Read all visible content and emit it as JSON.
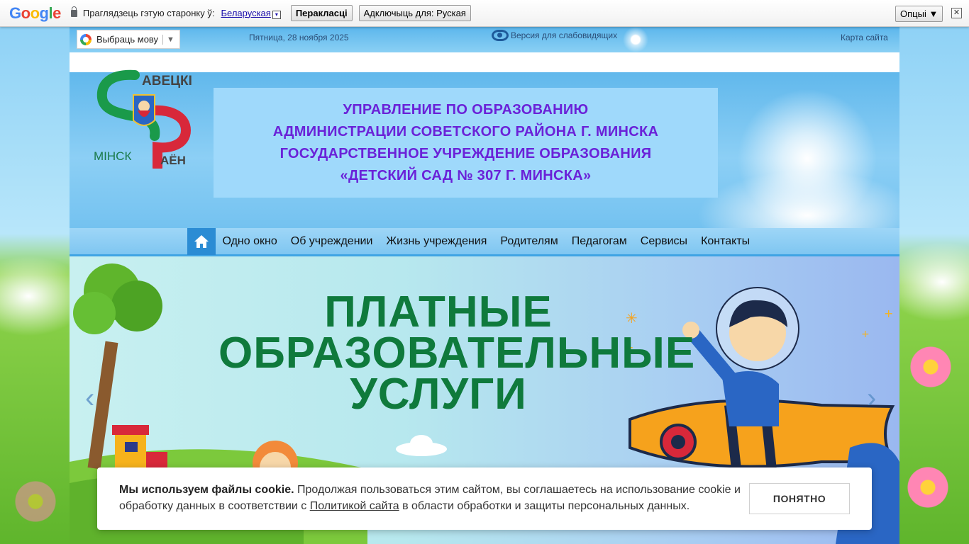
{
  "translate_bar": {
    "logo": [
      "G",
      "o",
      "o",
      "g",
      "l",
      "e"
    ],
    "prompt": "Праглядзець гэтую старонку ў:",
    "language": "Беларуская",
    "caret": "▾",
    "translate_button": "Перакласці",
    "turn_off_button": "Адключыць для: Руская",
    "options_button": "Опцыі ▼",
    "close": "✕"
  },
  "topbar": {
    "language_widget": "Выбраць мову",
    "language_widget_arrow": "▼",
    "date": "Пятница, 28 ноября 2025",
    "vision_version": "Версия для слабовидящих",
    "sitemap": "Карта сайта"
  },
  "header": {
    "logo_top": "АВЕЦКІ",
    "logo_bottom_left": "МІНСК",
    "logo_bottom_right": "АЁН",
    "title_lines": [
      "УПРАВЛЕНИЕ ПО ОБРАЗОВАНИЮ",
      "АДМИНИСТРАЦИИ СОВЕТСКОГО РАЙОНА Г. МИНСКА",
      "ГОСУДАРСТВЕННОЕ УЧРЕЖДЕНИЕ ОБРАЗОВАНИЯ",
      "«ДЕТСКИЙ САД № 307 Г. МИНСКА»"
    ],
    "colors": {
      "title": "#6a22d8",
      "logo_green": "#1a9a4a",
      "logo_red": "#d8283a"
    }
  },
  "nav": {
    "items": [
      "Одно окно",
      "Об учреждении",
      "Жизнь учреждения",
      "Родителям",
      "Педагогам",
      "Сервисы",
      "Контакты"
    ]
  },
  "slider": {
    "title_lines": [
      "ПЛАТНЫЕ",
      "ОБРАЗОВАТЕЛЬНЫЕ",
      "УСЛУГИ"
    ],
    "prev": "‹",
    "next": "›"
  },
  "cookie": {
    "bold": "Мы используем файлы cookie.",
    "text_before_link": " Продолжая пользоваться этим сайтом, вы соглашаетесь на использование cookie и обработку данных в соответствии с ",
    "link": "Политикой сайта",
    "text_after_link": " в области обработки и защиты персональных данных.",
    "button": "ПОНЯТНО"
  }
}
